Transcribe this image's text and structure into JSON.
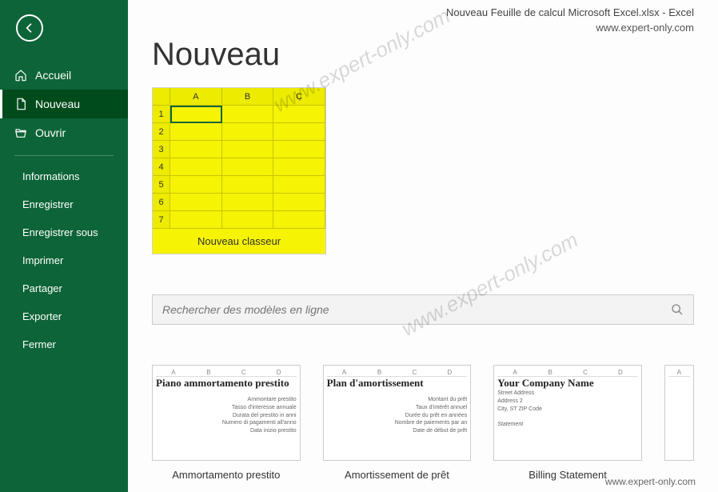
{
  "titlebar": "Nouveau Feuille de calcul Microsoft Excel.xlsx  -  Excel",
  "watermark_url": "www.expert-only.com",
  "page_title": "Nouveau",
  "sidebar": {
    "items": [
      {
        "label": "Accueil",
        "icon": "home"
      },
      {
        "label": "Nouveau",
        "icon": "file"
      },
      {
        "label": "Ouvrir",
        "icon": "folder"
      }
    ],
    "sub_items": [
      {
        "label": "Informations"
      },
      {
        "label": "Enregistrer"
      },
      {
        "label": "Enregistrer sous"
      },
      {
        "label": "Imprimer"
      },
      {
        "label": "Partager"
      },
      {
        "label": "Exporter"
      },
      {
        "label": "Fermer"
      }
    ]
  },
  "new_workbook": {
    "label": "Nouveau classeur",
    "cols": [
      "A",
      "B",
      "C"
    ],
    "rows": [
      "1",
      "2",
      "3",
      "4",
      "5",
      "6",
      "7"
    ]
  },
  "search": {
    "placeholder": "Rechercher des modèles en ligne"
  },
  "templates": [
    {
      "label": "Ammortamento prestito",
      "title": "Piano ammortamento prestito",
      "lines": [
        "Ammontare prestito",
        "Tasso d'interesse annuale",
        "Durata del prestito in anni",
        "Numero di pagamenti all'anno",
        "Data inizio prestito"
      ]
    },
    {
      "label": "Amortissement de prêt",
      "title": "Plan d'amortissement",
      "lines": [
        "Montant du prêt",
        "Taux d'intérêt annuel",
        "Durée du prêt en années",
        "Nombre de paiements par an",
        "Date de début de prêt"
      ]
    },
    {
      "label": "Billing Statement",
      "title": "Your Company Name",
      "lines": [
        "Street Address",
        "Address 2",
        "City, ST  ZIP Code",
        "",
        "Statement"
      ]
    }
  ]
}
